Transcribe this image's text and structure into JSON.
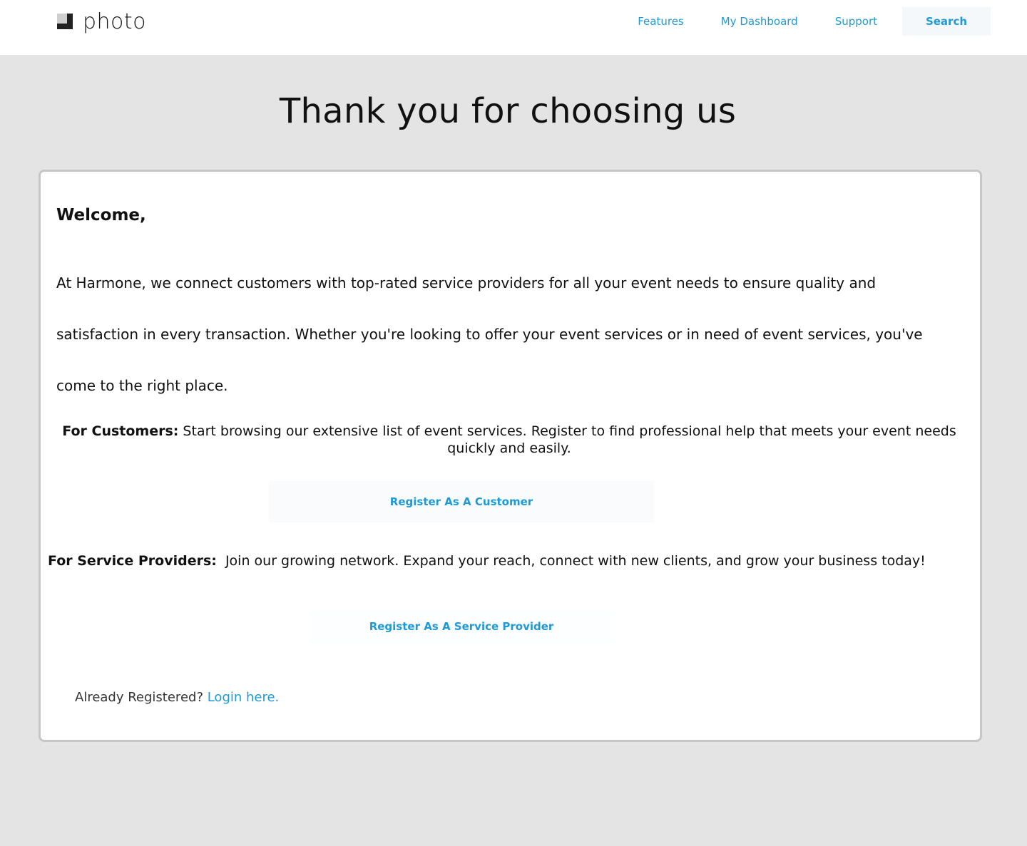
{
  "header": {
    "logo_text": "photo",
    "nav": [
      "Features",
      "My Dashboard",
      "Support"
    ],
    "search_label": "Search"
  },
  "page_title": "Thank you for choosing us",
  "card": {
    "welcome": "Welcome,",
    "intro": "At Harmone, we connect customers with top-rated service providers for all your event needs to ensure quality and satisfaction in every transaction. Whether you're looking to offer your event services or in need of event services, you've come to the right place.",
    "customers_label": "For Customers:",
    "customers_text": " Start browsing our extensive list of event services. Register to find professional help that meets your event needs quickly and easily.",
    "customer_button": "Register As A Customer",
    "providers_label": "For Service Providers:",
    "providers_text": "  Join our growing network. Expand your reach, connect with new clients, and grow your business today!",
    "provider_button": "Register As A Service Provider",
    "already_text": "Already Registered? ",
    "login_link": "Login here."
  },
  "colors": {
    "accent": "#1e9ad6",
    "background": "#e4e4e4",
    "card_border": "#c6c6c6"
  },
  "icons": {
    "logo": "photo-logo-icon"
  }
}
